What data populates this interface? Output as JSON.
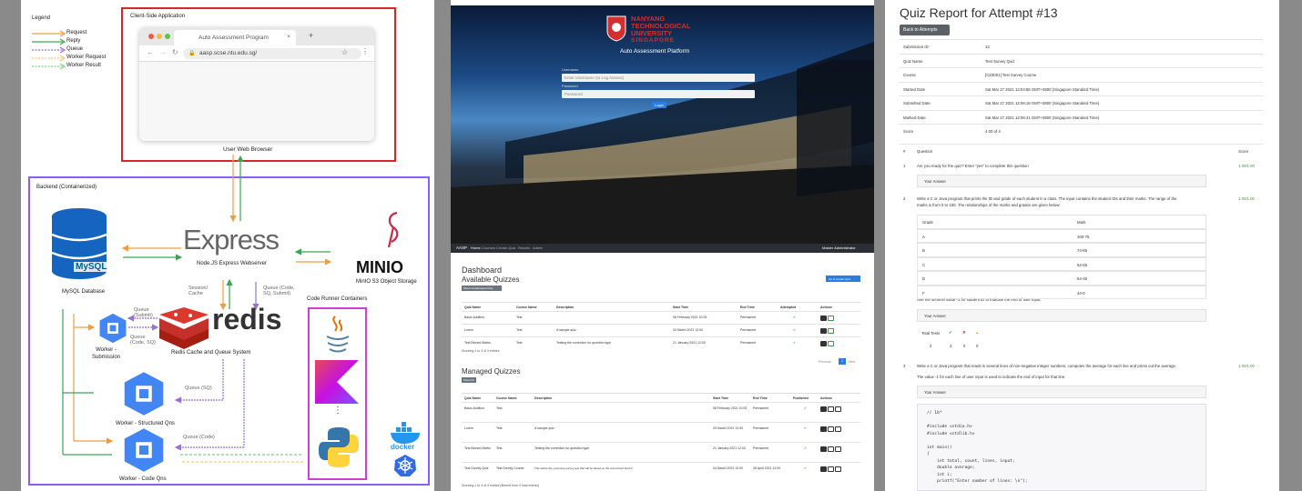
{
  "architecture": {
    "legend": {
      "title": "Legend",
      "items": [
        {
          "label": "Request",
          "color": "#f39c3c"
        },
        {
          "label": "Reply",
          "color": "#3aa655"
        },
        {
          "label": "Queue",
          "color": "#9a6fd8"
        },
        {
          "label": "Worker Request",
          "color": "#f3c878"
        },
        {
          "label": "Worker Result",
          "color": "#7ed18d"
        }
      ]
    },
    "client_title": "Client-Side Application",
    "browser": {
      "tab_title": "Auto Assessment Program",
      "url": "aasp.scse.ntu.edu.sg/",
      "caption": "User Web Browser"
    },
    "backend_title": "Backend (Containerized)",
    "express": {
      "logo": "Express",
      "caption": "Node.JS Express Webserver"
    },
    "mysql": {
      "logo": "MySQL",
      "caption": "MySQL Database"
    },
    "minio": {
      "logo": "MINIO",
      "caption": "MinIO S3 Object Storage"
    },
    "redis": {
      "logo": "redis",
      "caption": "Redis Cache and Queue System"
    },
    "session_label": "Session/\nCache",
    "queue_submit_label": "Queue (Code,\nSQ, Submit)",
    "crc_title": "Code Runner Containers",
    "workers": [
      {
        "caption": "Worker -\nSubmission",
        "queue_in": "Queue\n(Submit)",
        "queue_out": "Queue\n(Code, SQ)"
      },
      {
        "caption": "Worker - Structured Qns",
        "queue_label": "Queue (SQ)"
      },
      {
        "caption": "Worker - Code Qns",
        "queue_label": "Queue (Code)"
      }
    ],
    "docker": "docker"
  },
  "app": {
    "login": {
      "uni_line1": "NANYANG",
      "uni_line2": "TECHNOLOGICAL",
      "uni_line3": "UNIVERSITY",
      "uni_line4": "SINGAPORE",
      "platform": "Auto Assessment Platform",
      "username_label": "Username",
      "username_placeholder": "Enter Username (to Log Assess)",
      "password_label": "Password",
      "password_placeholder": "Password",
      "login_button": "Login"
    },
    "nav": {
      "brand": "AASP",
      "items": [
        "Home",
        "Courses",
        "Create Quiz",
        "Results",
        "Admin"
      ],
      "user": "Master Administrator"
    },
    "dashboard": {
      "title": "Dashboard",
      "available_title": "Available Quizzes",
      "show_btn": "Show Unattempted Only",
      "new_quiz_btn": "Go to Create Quiz",
      "columns": [
        "Quiz Name",
        "Course Name",
        "Description",
        "Start Time",
        "End Time",
        "Attempted",
        "Actions"
      ],
      "available_rows": [
        {
          "name": "Basic Addition",
          "course": "Test",
          "desc": "",
          "start": "08 February 2021 10:00",
          "end": "Permanent"
        },
        {
          "name": "Lorem",
          "course": "Test",
          "desc": "A sample quiz",
          "start": "03 March 2021 12:00",
          "end": "Permanent"
        },
        {
          "name": "Test Binned Marks",
          "course": "Test",
          "desc": "Testing the correction for question type",
          "start": "21 January 2021 12:00",
          "end": "Permanent"
        }
      ],
      "showing_text": "Showing 1 to 3 of 3 entries",
      "prev": "Previous",
      "page": "1",
      "next": "Next",
      "managed_title": "Managed Quizzes",
      "managed_btn": "Show All",
      "managed_columns": [
        "Quiz Name",
        "Course Name",
        "Description",
        "Start Time",
        "End Time",
        "Published",
        "Actions"
      ],
      "managed_rows": [
        {
          "name": "Basic Addition",
          "course": "Test",
          "desc": "",
          "start": "08 February 2021 10:00",
          "end": "Permanent"
        },
        {
          "name": "Lorem",
          "course": "Test",
          "desc": "A sample quiz",
          "start": "03 March 2021 12:00",
          "end": "Permanent"
        },
        {
          "name": "Test Binned Marks",
          "course": "Test",
          "desc": "Testing the correction for question type",
          "start": "21 January 2021 12:00",
          "end": "Permanent"
        },
        {
          "name": "Test Survey Quiz",
          "course": "Test Survey Course",
          "desc": "This will be the upcoming survey test that will be based on the announced launch",
          "start": "04 March 2021 12:00",
          "end": "26 April 2021 12:00"
        }
      ],
      "managed_showing": "Showing 1 to 4 of 4 entries (filtered from 4 total entries)"
    }
  },
  "report": {
    "title": "Quiz Report for Attempt #13",
    "back_btn": "Back to Attempts",
    "summary": [
      {
        "k": "Submission ID",
        "v": "13"
      },
      {
        "k": "Quiz Name",
        "v": "Test Survey Quiz"
      },
      {
        "k": "Course",
        "v": "[CZ3001] Test Survey Course"
      },
      {
        "k": "Started Date",
        "v": "Sat Mar 27 2021 12:04:58 GMT+0800 (Singapore Standard Time)"
      },
      {
        "k": "Submitted Date",
        "v": "Sat Mar 27 2021 12:06:19 GMT+0800 (Singapore Standard Time)"
      },
      {
        "k": "Marked Date",
        "v": "Sat Mar 27 2021 12:06:41 GMT+0800 (Singapore Standard Time)"
      },
      {
        "k": "Score",
        "v": "4.00 of 4"
      }
    ],
    "q_head": {
      "num": "#",
      "question": "Question",
      "score": "Score"
    },
    "q1": {
      "num": "1",
      "text": "Are you ready for the quiz? Enter \"yes\" to complete this question",
      "score": "1.00/1.00",
      "answer_label": "Your Answer"
    },
    "q2": {
      "num": "2",
      "text1": "Write a C or Java program that prints the ID and grade of each student in a class. The input contains the student IDs and their marks. The range of the",
      "text2": "marks is from 0 to 100. The relationships of the marks and grades are given below:",
      "score": "1.00/1.00",
      "grade_head": "Grade",
      "mark_head": "Mark",
      "grades": [
        {
          "g": "A",
          "m": "100-75"
        },
        {
          "g": "B",
          "m": "74-65"
        },
        {
          "g": "C",
          "m": "64-55"
        },
        {
          "g": "D",
          "m": "54-45"
        },
        {
          "g": "F",
          "m": "44-0"
        }
      ],
      "sentinel": "Use the sentinel value -1 for student ID to indicate the end of user input.",
      "answer_label": "Your Answer",
      "tests_label": "Total Tests",
      "tests": [
        "2",
        "2",
        "0",
        "0"
      ]
    },
    "q3": {
      "num": "3",
      "text": "Write a C or Java program that reads in several lines of non-negative integer numbers, computes the average for each line and prints out the average.",
      "text2": "The value -1 for each line of user input is used to indicate the end of input for that line.",
      "score": "1.00/1.00",
      "answer_label": "Your Answer",
      "code": [
        "// 1b*",
        "",
        "#include <stdio.h>",
        "#include <stdlib.h>",
        "",
        "int main()",
        "{",
        "    int total, count, lines, input;",
        "    double average;",
        "    int i;",
        "    printf(\"Enter number of lines: \\n\");"
      ]
    }
  }
}
